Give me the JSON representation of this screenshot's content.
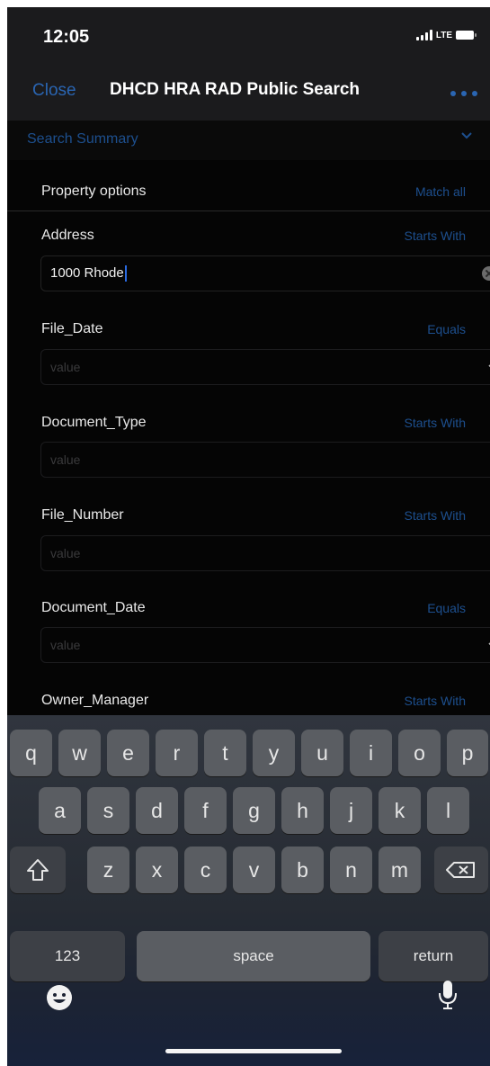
{
  "status_bar": {
    "time": "12:05",
    "network": "LTE"
  },
  "nav": {
    "close_label": "Close",
    "title": "DHCD HRA RAD Public Search"
  },
  "summary": {
    "label": "Search Summary"
  },
  "property_options": {
    "label": "Property options",
    "match_label": "Match all"
  },
  "fields": [
    {
      "label": "Address",
      "operator": "Starts With",
      "value": "1000 Rhode",
      "placeholder": ""
    },
    {
      "label": "File_Date",
      "operator": "Equals",
      "value": "",
      "placeholder": "value"
    },
    {
      "label": "Document_Type",
      "operator": "Starts With",
      "value": "",
      "placeholder": "value"
    },
    {
      "label": "File_Number",
      "operator": "Starts With",
      "value": "",
      "placeholder": "value"
    },
    {
      "label": "Document_Date",
      "operator": "Equals",
      "value": "",
      "placeholder": "value"
    },
    {
      "label": "Owner_Manager",
      "operator": "Starts With",
      "value": "",
      "placeholder": ""
    }
  ],
  "keyboard": {
    "row1": [
      "q",
      "w",
      "e",
      "r",
      "t",
      "y",
      "u",
      "i",
      "o",
      "p"
    ],
    "row2": [
      "a",
      "s",
      "d",
      "f",
      "g",
      "h",
      "j",
      "k",
      "l"
    ],
    "row3": [
      "z",
      "x",
      "c",
      "v",
      "b",
      "n",
      "m"
    ],
    "numbers_label": "123",
    "space_label": "space",
    "return_label": "return"
  },
  "icons": {
    "shift": "shift-icon",
    "delete": "delete-icon",
    "emoji": "emoji-icon",
    "mic": "microphone-icon"
  },
  "colors": {
    "accent": "#2a65b2",
    "background": "#050505",
    "navbar": "#1b1b1d"
  }
}
